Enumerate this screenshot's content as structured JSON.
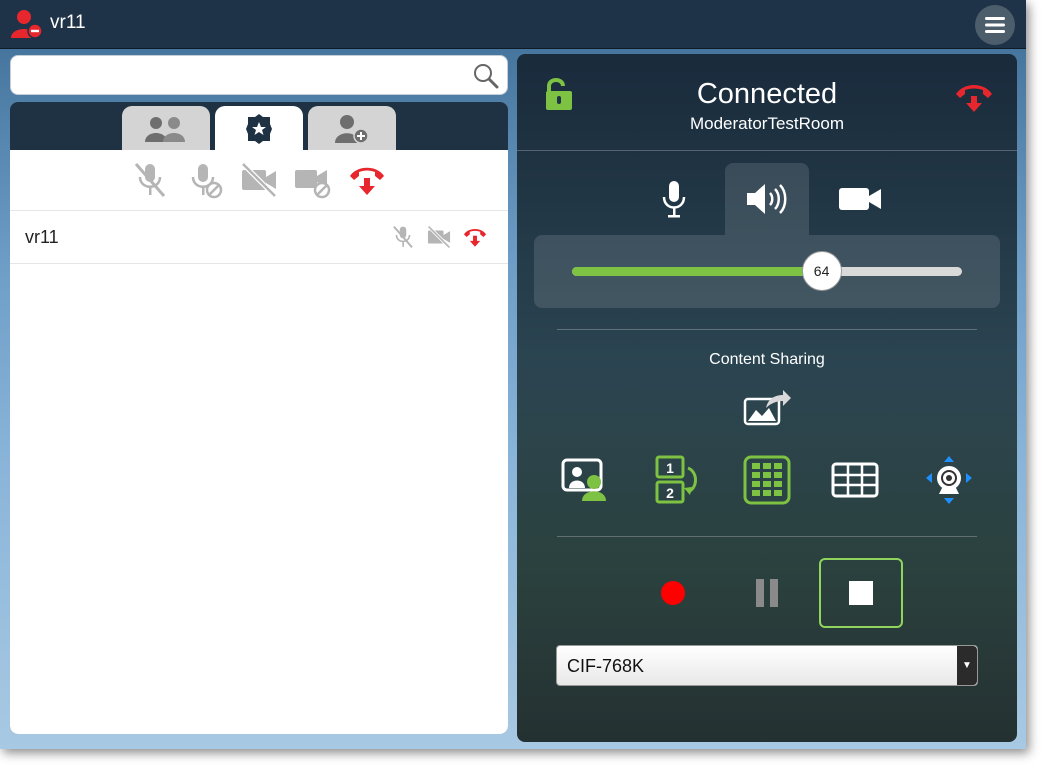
{
  "app": {
    "user_name": "vr11"
  },
  "search": {
    "placeholder": "",
    "value": ""
  },
  "tabs": [
    {
      "icon": "participants-icon",
      "active": false
    },
    {
      "icon": "moderator-badge-icon",
      "active": true
    },
    {
      "icon": "add-participant-icon",
      "active": false
    }
  ],
  "moderator_controls": [
    "mute-all-mic-icon",
    "block-mic-icon",
    "video-off-all-icon",
    "block-video-icon",
    "disconnect-all-icon"
  ],
  "participants": [
    {
      "name": "vr11",
      "controls": [
        "mic-muted-icon",
        "video-off-icon",
        "hangup-icon"
      ]
    }
  ],
  "call": {
    "status": "Connected",
    "room": "ModeratorTestRoom"
  },
  "device_tabs": [
    "microphone-icon",
    "speaker-icon",
    "camera-icon"
  ],
  "volume": {
    "value": 64,
    "label": "64",
    "max": 100
  },
  "content_sharing": {
    "label": "Content Sharing"
  },
  "layouts": [
    "self-view-icon",
    "layout-1-2-icon",
    "keypad-icon",
    "grid-layout-icon",
    "camera-control-icon"
  ],
  "recording": {
    "controls": [
      "record-icon",
      "pause-icon",
      "stop-icon"
    ]
  },
  "bitrate": {
    "selected": "CIF-768K"
  },
  "colors": {
    "accent_green": "#7dc242",
    "hangup_red": "#e8262d",
    "topbar": "#1e3347"
  }
}
